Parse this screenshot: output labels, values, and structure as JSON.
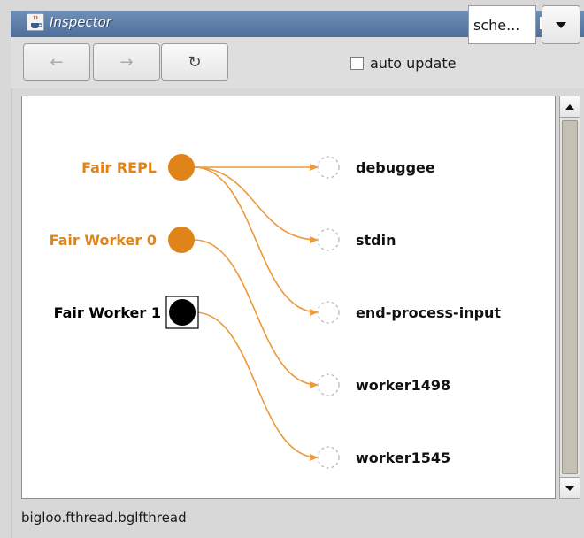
{
  "window": {
    "title": "Inspector",
    "app_icon": "java-cup-icon",
    "controls": [
      "minimize-icon",
      "maximize-icon",
      "close-icon"
    ]
  },
  "toolbar": {
    "back_label": "←",
    "forward_label": "→",
    "refresh_label": "↻",
    "auto_update_label": "auto update",
    "auto_update_checked": false,
    "selector_value": "sche..."
  },
  "graph": {
    "colors": {
      "active": "#e0841a",
      "edge": "#ec9a3c",
      "target": "#b8b8b8",
      "inactive": "#000000"
    },
    "sources": [
      {
        "label": "Fair REPL",
        "active": true
      },
      {
        "label": "Fair Worker 0",
        "active": true
      },
      {
        "label": "Fair Worker 1",
        "active": false,
        "selected": true
      }
    ],
    "targets": [
      {
        "label": "debuggee"
      },
      {
        "label": "stdin"
      },
      {
        "label": "end-process-input"
      },
      {
        "label": "worker1498"
      },
      {
        "label": "worker1545"
      }
    ],
    "edges": [
      {
        "from": 0,
        "to": 0
      },
      {
        "from": 0,
        "to": 1
      },
      {
        "from": 0,
        "to": 2
      },
      {
        "from": 1,
        "to": 3
      },
      {
        "from": 2,
        "to": 4
      }
    ]
  },
  "status": {
    "text": "bigloo.fthread.bglfthread"
  }
}
